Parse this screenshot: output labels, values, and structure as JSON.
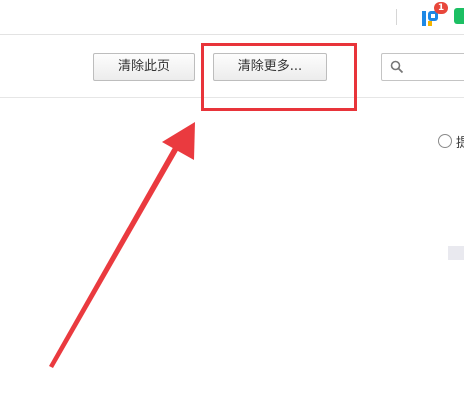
{
  "topbar": {
    "extension_badge_count": "1",
    "extension_icon": "pinyin-p-icon",
    "green_icon": "green-app-icon"
  },
  "toolbar": {
    "clear_page_label": "清除此页",
    "clear_more_label": "清除更多...",
    "search_placeholder": ""
  },
  "options": {
    "radio_label_partial": "提"
  },
  "annotation": {
    "highlight_color": "#e8343a",
    "arrow_color": "#ea3a3f"
  }
}
